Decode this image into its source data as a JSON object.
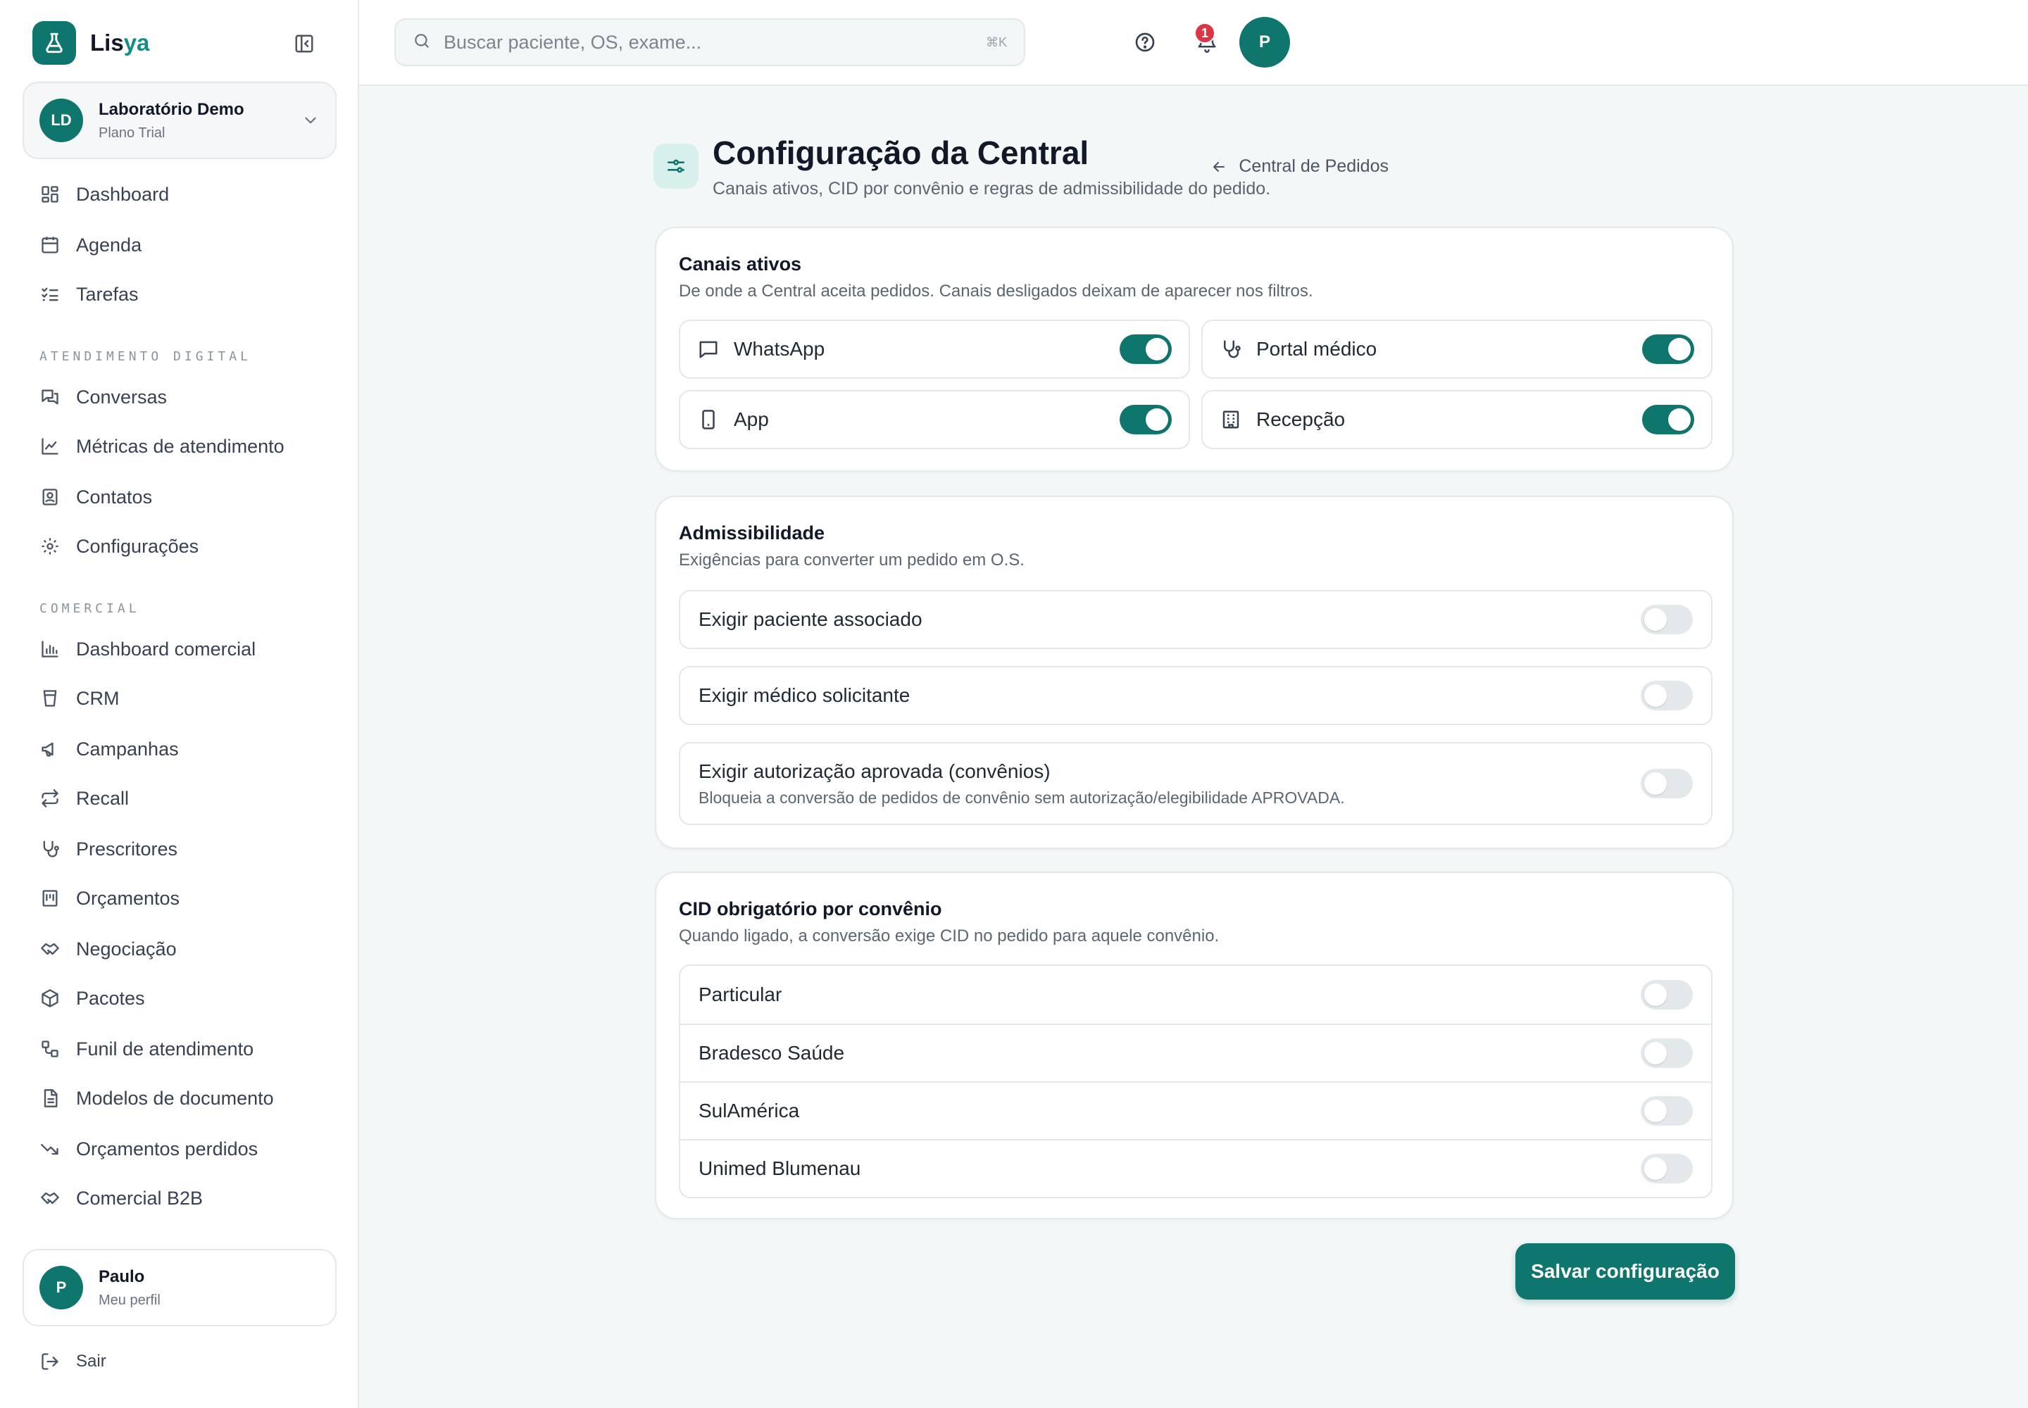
{
  "brand": {
    "name_part1": "Lis",
    "name_part2": "ya"
  },
  "org": {
    "initials": "LD",
    "name": "Laboratório Demo",
    "plan": "Plano Trial"
  },
  "nav": {
    "dashboard": "Dashboard",
    "agenda": "Agenda",
    "tarefas": "Tarefas",
    "section_digital": "ATENDIMENTO DIGITAL",
    "conversas": "Conversas",
    "metricas": "Métricas de atendimento",
    "contatos": "Contatos",
    "configuracoes": "Configurações",
    "section_comercial": "COMERCIAL",
    "dashboard_comercial": "Dashboard comercial",
    "crm": "CRM",
    "campanhas": "Campanhas",
    "recall": "Recall",
    "prescritores": "Prescritores",
    "orcamentos": "Orçamentos",
    "negociacao": "Negociação",
    "pacotes": "Pacotes",
    "funil": "Funil de atendimento",
    "modelos": "Modelos de documento",
    "orcamentos_perdidos": "Orçamentos perdidos",
    "comercial_b2b": "Comercial B2B"
  },
  "profile": {
    "initial": "P",
    "name": "Paulo",
    "sub": "Meu perfil"
  },
  "logout": "Sair",
  "topbar": {
    "search_placeholder": "Buscar paciente, OS, exame...",
    "search_shortcut": "⌘K",
    "notifications_count": "1",
    "avatar_initial": "P"
  },
  "page": {
    "title": "Configuração da Central",
    "subtitle": "Canais ativos, CID por convênio e regras de admissibilidade do pedido.",
    "back_link": "Central de Pedidos"
  },
  "channels": {
    "title": "Canais ativos",
    "subtitle": "De onde a Central aceita pedidos. Canais desligados deixam de aparecer nos filtros.",
    "items": [
      {
        "label": "WhatsApp",
        "icon": "message-square-icon",
        "enabled": true
      },
      {
        "label": "Portal médico",
        "icon": "stethoscope-icon",
        "enabled": true
      },
      {
        "label": "App",
        "icon": "smartphone-icon",
        "enabled": true
      },
      {
        "label": "Recepção",
        "icon": "building-icon",
        "enabled": true
      }
    ]
  },
  "admissibility": {
    "title": "Admissibilidade",
    "subtitle": "Exigências para converter um pedido em O.S.",
    "items": [
      {
        "label": "Exigir paciente associado",
        "enabled": false
      },
      {
        "label": "Exigir médico solicitante",
        "enabled": false
      },
      {
        "label": "Exigir autorização aprovada (convênios)",
        "description": "Bloqueia a conversão de pedidos de convênio sem autorização/elegibilidade APROVADA.",
        "enabled": false
      }
    ]
  },
  "cid": {
    "title": "CID obrigatório por convênio",
    "subtitle": "Quando ligado, a conversão exige CID no pedido para aquele convênio.",
    "items": [
      {
        "label": "Particular",
        "enabled": false
      },
      {
        "label": "Bradesco Saúde",
        "enabled": false
      },
      {
        "label": "SulAmérica",
        "enabled": false
      },
      {
        "label": "Unimed Blumenau",
        "enabled": false
      }
    ]
  },
  "save_button": "Salvar configuração",
  "colors": {
    "brand": "#0f766e",
    "badge": "#dc3545",
    "toggle_off": "#e3e8eb",
    "background": "#f4f7f8"
  }
}
